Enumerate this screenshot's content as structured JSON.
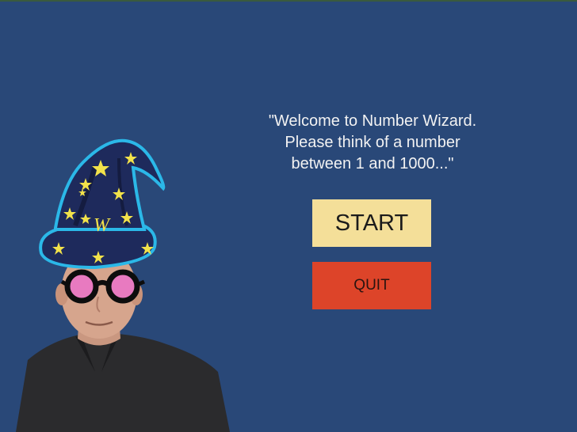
{
  "game": {
    "welcome_text": "\"Welcome to Number Wizard.\nPlease think of a number\nbetween 1 and 1000...\"",
    "start_label": "START",
    "quit_label": "QUIT"
  },
  "colors": {
    "background": "#294878",
    "start_button": "#f4df99",
    "quit_button": "#dd4429",
    "hat": "#1e2a5c",
    "hat_outline": "#2bb8e8",
    "stars": "#f2e24a",
    "glasses_lens": "#e87ac0"
  },
  "wizard": {
    "hat_letter": "W",
    "icons": [
      "wizard-hat-icon",
      "star-icon",
      "glasses-icon"
    ]
  }
}
